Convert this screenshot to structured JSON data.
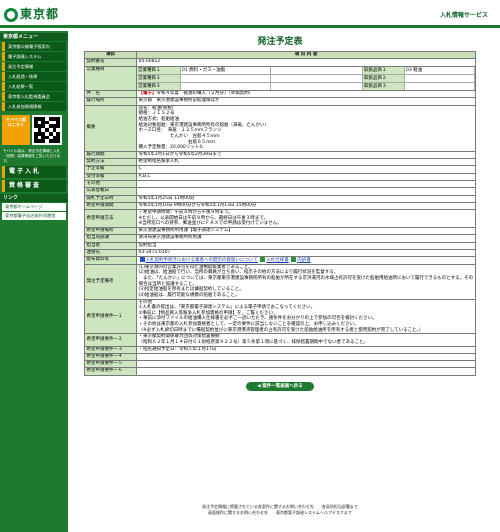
{
  "header": {
    "logo": "東京都",
    "service": "入札情報サービス"
  },
  "sidebar": {
    "menu_head": "東京都メニュー",
    "menu": [
      "東京都公報電子版案内",
      "電子調達システム",
      "発注予定情報",
      "入札経過・結果",
      "入札結果一覧",
      "東京都入札監視委員会",
      "入札参加資格情報"
    ],
    "mobile_btn": "モバイル版 はこちら",
    "mobile_note": "モバイル版は、発注予定情報と入札（見積）結果情報をご覧いただけます。",
    "big": [
      "電子入札",
      "資格審査"
    ],
    "link_head": "リンク",
    "links": [
      "東京都ホームページ",
      "東京都電子自治体共同運営"
    ]
  },
  "page_title": "発注予定表",
  "table_head": {
    "k": "項目",
    "v": "項 目 内 容"
  },
  "rows": {
    "contract_no": {
      "k": "契約番号",
      "v": "04-00812"
    },
    "biz_type": {
      "k": "営業種目",
      "sub": [
        [
          "営業種目１",
          "01 燃料・ガス・油脂",
          "取扱品目１",
          "03 軽油"
        ],
        [
          "営業種目２",
          "",
          "取扱品目２",
          ""
        ],
        [
          "営業種目３",
          "",
          "取扱品目３",
          ""
        ]
      ]
    },
    "name": {
      "k": "件　名",
      "tag": "【電子】",
      "v": "令和４年度　軽油の購入（２月分）（単価契約）"
    },
    "dept": {
      "k": "履行場所",
      "v": "東京都　東京港建設事務所前処理場ほか"
    },
    "summary": {
      "k": "概要",
      "v": "品名：軽油(免税)\n規格：ＪＩＳ２号\n給油方式：船舶給油\n給油対象船舶：東京港建設事務所所有の船舶（海竜、たんかい）\nホース口径：　海竜　１２５ｍｍフランジ\n　　　　　　　たんかい　左舷４５ｍｍ\n　　　　　　　　　　　右舷６５ｍｍ\n購入予定数量：20,000リットル"
    },
    "period": {
      "k": "履行期間",
      "v": "令和5年2月1日から令和5年2月28日まで"
    },
    "method": {
      "k": "契約方法",
      "v": "希望制指名競争入札"
    },
    "grade": {
      "k": "予定等級",
      "v": "C"
    },
    "accept": {
      "k": "受付等級",
      "v": "A,B,C"
    },
    "other": {
      "k": "その他",
      "v": ""
    },
    "pub_date": {
      "k": "公表登載日",
      "v": ""
    },
    "open_date": {
      "k": "開札予定日時",
      "v": "令和5年1月25日 11時00分"
    },
    "app_period": {
      "k": "希望申請期間",
      "v": "令和5年1月10日 9時00分から令和5年1月13日 15時00分"
    },
    "app_notes": {
      "k": "希望申請方法",
      "v": "・希望申請時間：午前８時から午後９時まで。\n※ただし、公表開始日は午前９時から、最終日は午後３時まで。\n※当所窓口への持参、郵送並びにＦＡＸでの申請は受付けていません。"
    },
    "app_office": {
      "k": "希望申請場所",
      "v": "東京港建設事務所所用課【電子調達システム】"
    },
    "dept2": {
      "k": "担当局部課",
      "v": "港湾局東京港建設事務所所用課"
    },
    "staff": {
      "k": "担当者",
      "v": "契約担当"
    },
    "tel": {
      "k": "連絡先",
      "v": "03-3471-0107"
    },
    "docs": {
      "k": "配布資料等",
      "l1": "入札契約手続きにおける業者への開示の取扱いについて",
      "l2": "入札仕様書",
      "l3": "内訳書"
    },
    "notes": {
      "k": "発注予定備考",
      "v": "(1)東京港内の営業許可を得た油類取扱業者であること。\n(2)給油は、給油船で行い、当所の職員が立ち会い、指示その他の方法により履行状況を監督する。\n　また、「たんかい」については、東京都東京港建設事務所所有の船舶が所在する京浜運河の水域占有許可を受けた船舶用給油所において履行できるものとする。その場合は当所と協議すること。\n(3)指定給油船を所有または傭船契約していること。\n(4)給油船は、履行可能な規模の船舶であること。"
    },
    "hope1": {
      "k": "希望申請要件一１",
      "v": "その他\n①入札書の提出は、「東京都電子調達システム」による電子申請でおこなってください。\n②事前に【物品買入等競争入札参加資格の申請】を、ご覧ください。\n・事前に添付ファイルの給油購入仕様書を必ずご一読いただき、諸条件をお分かりの上で参加の可否を検討ください。\n・その他は東京都の入札参加資格者として、一定の要件に該当しないことを確認の上、お申し込みください。\n（※必ず入札締切日時までに備船契約並びに東京港港湾管理者の占有許可を受けた船舶給油所を所有する者と使用契約が完了していること。）"
    },
    "hope2": {
      "k": "希望申請要件一２",
      "v": "・東京都契約関係暴力団等対策措置要綱\n（昭和６２年１月１４日付６１財経庶第９２２号）第５条第１項に基づく、排除措置期間中でない者であること。"
    },
    "hope3": {
      "k": "希望申請要件一３",
      "v": "・指名通知予定日：令和５年１月17日"
    },
    "hope4": {
      "k": "希望申請要件一４",
      "v": ""
    },
    "hope5": {
      "k": "希望申請要件一５",
      "v": ""
    },
    "hope6": {
      "k": "希望申請要件一６",
      "v": ""
    }
  },
  "back_btn": "◀ 案件一覧画面へ戻る",
  "footer": [
    "発注予定情報に掲載されている各案件に関するお問い合わせ先　　各局所担当部署まで",
    "画面操作に関するお問い合わせ先　　東京都電子調達システムヘルプデスクまで"
  ]
}
